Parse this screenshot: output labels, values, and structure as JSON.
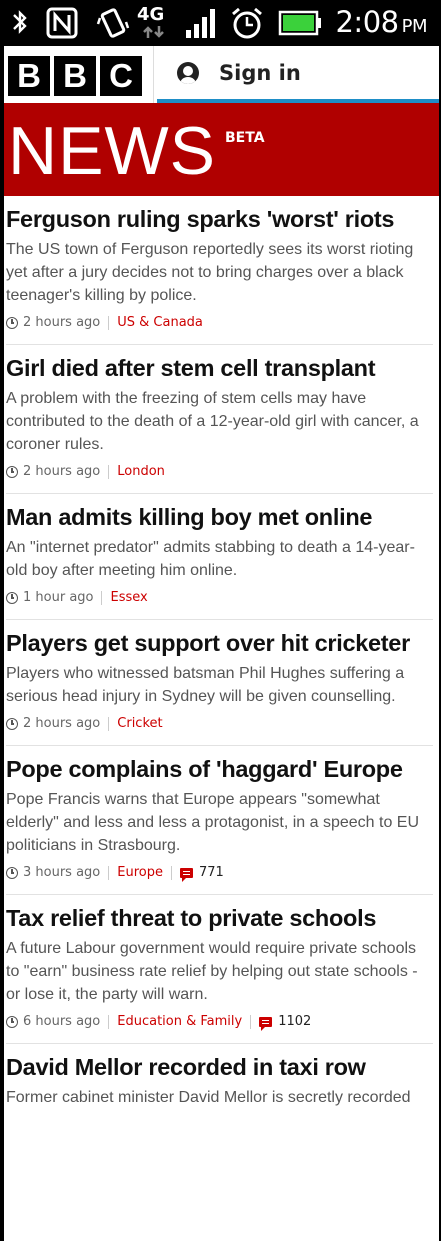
{
  "status_bar": {
    "time": "2:08",
    "ampm": "PM",
    "network": "4G"
  },
  "header": {
    "logo_letters": [
      "B",
      "B",
      "C"
    ],
    "sign_in_label": "Sign in"
  },
  "banner": {
    "title": "NEWS",
    "badge": "BETA"
  },
  "articles": [
    {
      "headline": "Ferguson ruling sparks 'worst' riots",
      "summary": "The US town of Ferguson reportedly sees its worst rioting yet after a jury decides not to bring charges over a black teenager's killing by police.",
      "time": "2 hours ago",
      "section": "US & Canada",
      "comments": null
    },
    {
      "headline": "Girl died after stem cell transplant",
      "summary": "A problem with the freezing of stem cells may have contributed to the death of a 12-year-old girl with cancer, a coroner rules.",
      "time": "2 hours ago",
      "section": "London",
      "comments": null
    },
    {
      "headline": "Man admits killing boy met online",
      "summary": "An \"internet predator\" admits stabbing to death a 14-year-old boy after meeting him online.",
      "time": "1 hour ago",
      "section": "Essex",
      "comments": null
    },
    {
      "headline": "Players get support over hit cricketer",
      "summary": "Players who witnessed batsman Phil Hughes suffering a serious head injury in Sydney will be given counselling.",
      "time": "2 hours ago",
      "section": "Cricket",
      "comments": null
    },
    {
      "headline": "Pope complains of 'haggard' Europe",
      "summary": "Pope Francis warns that Europe appears \"somewhat elderly\" and less and less a protagonist, in a speech to EU politicians in Strasbourg.",
      "time": "3 hours ago",
      "section": "Europe",
      "comments": "771"
    },
    {
      "headline": "Tax relief threat to private schools",
      "summary": "A future Labour government would require private schools to \"earn\" business rate relief by helping out state schools - or lose it, the party will warn.",
      "time": "6 hours ago",
      "section": "Education & Family",
      "comments": "1102"
    },
    {
      "headline": "David Mellor recorded in taxi row",
      "summary": "Former cabinet minister David Mellor is secretly recorded",
      "time": null,
      "section": null,
      "comments": null
    }
  ]
}
